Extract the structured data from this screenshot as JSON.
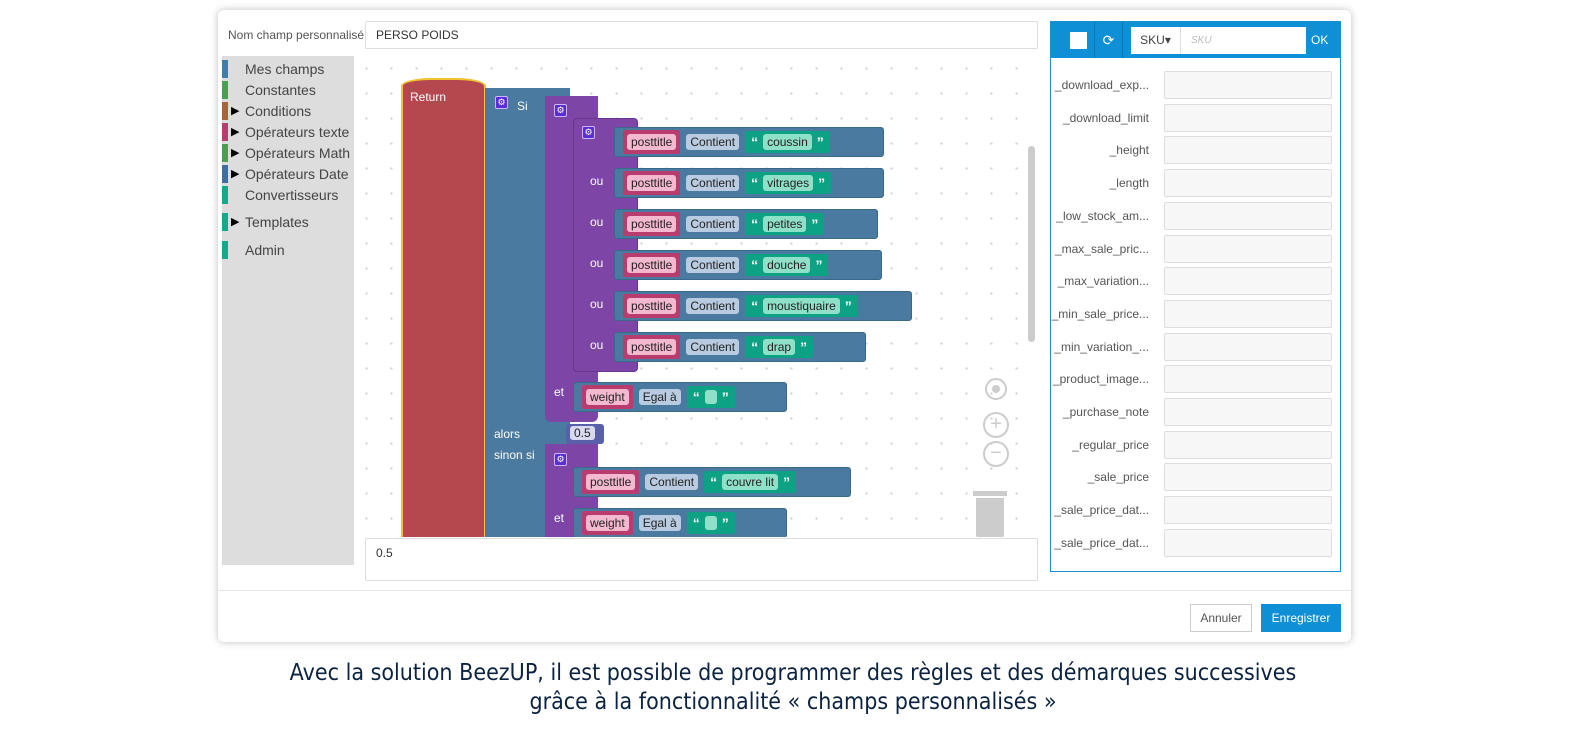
{
  "form": {
    "name_label": "Nom champ personnalisé",
    "name_value": "PERSO POIDS",
    "result_value": "0.5"
  },
  "toolbox": [
    {
      "label": "Mes champs",
      "color": "#3d7fa8",
      "arrow": false
    },
    {
      "label": "Constantes",
      "color": "#4aa050",
      "arrow": false
    },
    {
      "label": "Conditions",
      "color": "#a8643d",
      "arrow": true
    },
    {
      "label": "Opérateurs texte",
      "color": "#b83d6e",
      "arrow": true
    },
    {
      "label": "Opérateurs Math",
      "color": "#4aa050",
      "arrow": true
    },
    {
      "label": "Opérateurs Date",
      "color": "#3d6fa0",
      "arrow": true
    },
    {
      "label": "Convertisseurs",
      "color": "#15a88a",
      "arrow": false
    },
    {
      "label": "Templates",
      "color": "#15a88a",
      "arrow": true
    },
    {
      "label": "Admin",
      "color": "#15a88a",
      "arrow": false
    }
  ],
  "blocks": {
    "return": "Return",
    "if": "Si",
    "or": "ou",
    "and": "et",
    "then": "alors",
    "elseif": "sinon si",
    "then_value": "0.5",
    "conditions": [
      {
        "field": "posttitle",
        "op": "Contient",
        "text": "coussin"
      },
      {
        "field": "posttitle",
        "op": "Contient",
        "text": "vitrages"
      },
      {
        "field": "posttitle",
        "op": "Contient",
        "text": "petites"
      },
      {
        "field": "posttitle",
        "op": "Contient",
        "text": "douche"
      },
      {
        "field": "posttitle",
        "op": "Contient",
        "text": "moustiquaire"
      },
      {
        "field": "posttitle",
        "op": "Contient",
        "text": "drap"
      }
    ],
    "weight_cond": {
      "field": "weight",
      "op": "Egal à",
      "text": ""
    },
    "elseif_cond": {
      "field": "posttitle",
      "op": "Contient",
      "text": "couvre lit"
    },
    "elseif_weight": {
      "field": "weight",
      "op": "Egal à",
      "text": ""
    }
  },
  "panel": {
    "key_select": "SKU",
    "key_placeholder": "SKU",
    "ok": "OK",
    "fields": [
      "_download_exp...",
      "_download_limit",
      "_height",
      "_length",
      "_low_stock_am...",
      "_max_sale_pric...",
      "_max_variation...",
      "_min_sale_price...",
      "_min_variation_...",
      "_product_image...",
      "_purchase_note",
      "_regular_price",
      "_sale_price",
      "_sale_price_dat...",
      "_sale_price_dat..."
    ]
  },
  "footer": {
    "cancel": "Annuler",
    "save": "Enregistrer"
  },
  "caption": {
    "line1": "Avec la solution BeezUP, il est possible de programmer des règles et des démarques successives",
    "line2": "grâce à la fonctionnalité « champs personnalisés »"
  },
  "colors": {
    "accent": "#0f8fd6",
    "return": "#b5474f",
    "if": "#4a7aa0",
    "logic": "#7d45a6",
    "text": "#0da283"
  }
}
